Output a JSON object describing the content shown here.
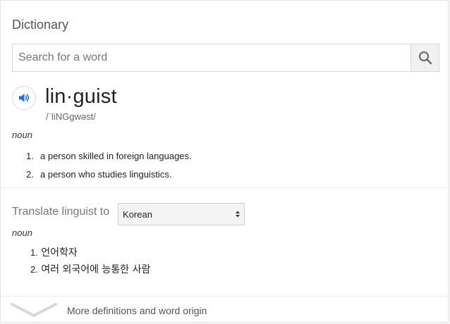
{
  "header": {
    "title": "Dictionary"
  },
  "search": {
    "placeholder": "Search for a word",
    "value": ""
  },
  "entry": {
    "word": "lin·guist",
    "phonetic": "/ˈliNGɡwəst/",
    "part_of_speech": "noun",
    "definitions": [
      {
        "num": "1.",
        "text": "a person skilled in foreign languages."
      },
      {
        "num": "2.",
        "text": "a person who studies linguistics."
      }
    ]
  },
  "translate": {
    "label": "Translate linguist to",
    "selected_language": "Korean",
    "part_of_speech": "noun",
    "definitions": [
      {
        "num": "1.",
        "text": "언어학자"
      },
      {
        "num": "2.",
        "text": "여러 외국어에 능통한 사람"
      }
    ]
  },
  "footer": {
    "more_label": "More definitions and word origin"
  },
  "colors": {
    "speaker_blue": "#1a73e8",
    "card_bg": "#ffffff",
    "chevron": "#d8d8d8"
  }
}
